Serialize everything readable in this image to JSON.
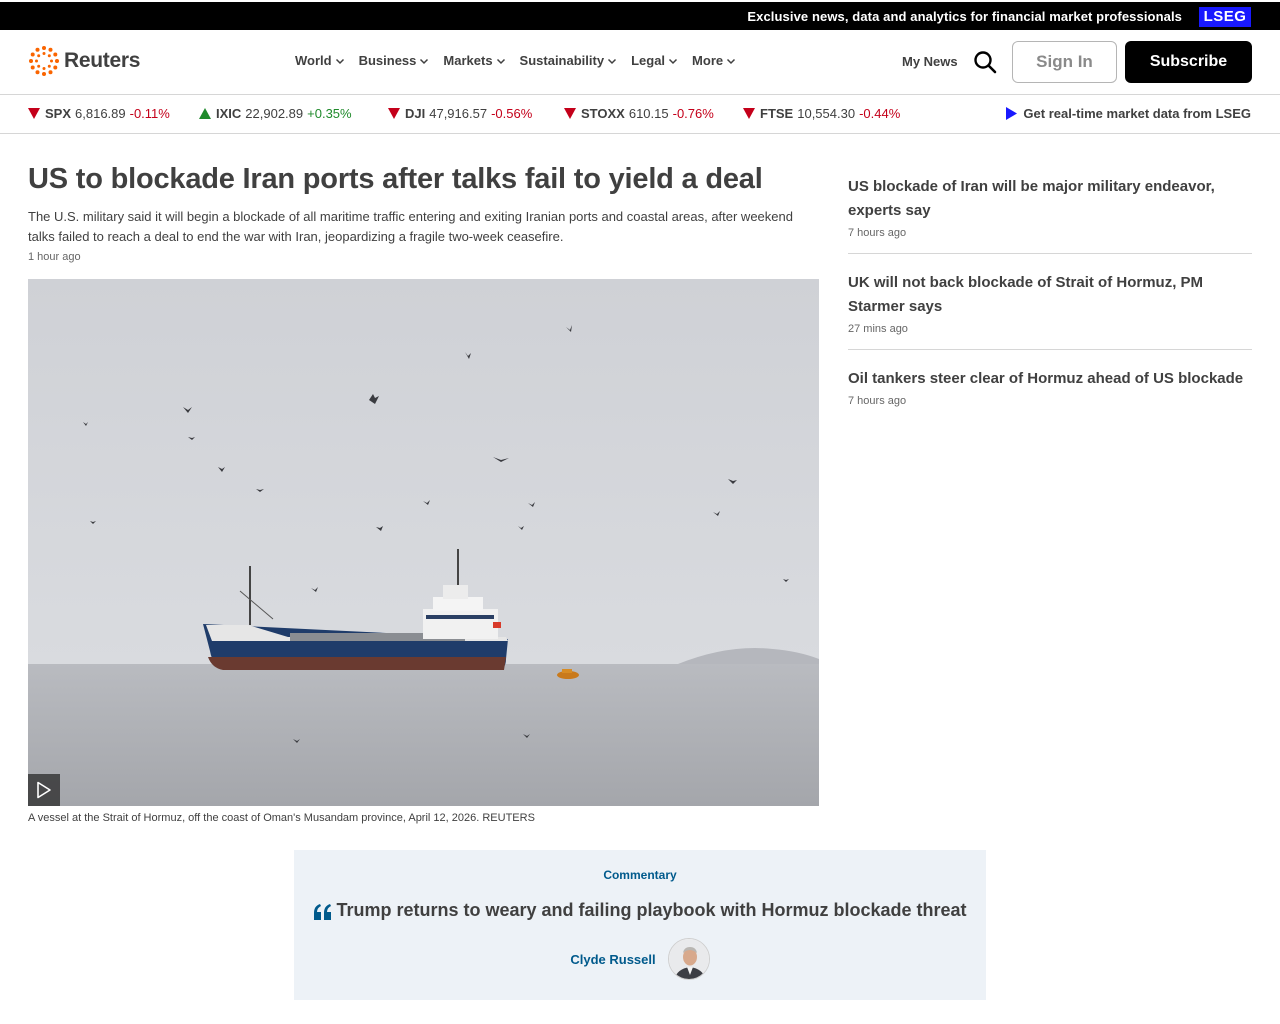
{
  "banner": {
    "text": "Exclusive news, data and analytics for financial market professionals",
    "badge": "LSEG"
  },
  "header": {
    "logo_text": "Reuters",
    "nav": [
      {
        "label": "World",
        "icon": "chevron-down-icon"
      },
      {
        "label": "Business",
        "icon": "chevron-down-icon"
      },
      {
        "label": "Markets",
        "icon": "chevron-down-icon"
      },
      {
        "label": "Sustainability",
        "icon": "chevron-down-icon"
      },
      {
        "label": "Legal",
        "icon": "chevron-down-icon"
      },
      {
        "label": "More",
        "icon": "chevron-down-icon"
      }
    ],
    "my_news": "My News",
    "sign_in": "Sign In",
    "subscribe": "Subscribe"
  },
  "ticker": {
    "items": [
      {
        "symbol": "SPX",
        "value": "6,816.89",
        "change": "-0.11%",
        "direction": "down"
      },
      {
        "symbol": "IXIC",
        "value": "22,902.89",
        "change": "+0.35%",
        "direction": "up"
      },
      {
        "symbol": "DJI",
        "value": "47,916.57",
        "change": "-0.56%",
        "direction": "down"
      },
      {
        "symbol": "STOXX",
        "value": "610.15",
        "change": "-0.76%",
        "direction": "down"
      },
      {
        "symbol": "FTSE",
        "value": "10,554.30",
        "change": "-0.44%",
        "direction": "down"
      }
    ],
    "lseg_link": "Get real-time market data from LSEG"
  },
  "main": {
    "headline": "US to blockade Iran ports after talks fail to yield a deal",
    "summary": "The U.S. military said it will begin a blockade of all maritime traffic entering and exiting Iranian ports and coastal areas, after weekend talks failed to reach a deal to end the war with Iran, jeopardizing a fragile two-week ceasefire.",
    "time": "1 hour ago",
    "caption": "A vessel at the Strait of Hormuz, off the coast of Oman's Musandam province, April 12, 2026. REUTERS"
  },
  "side": [
    {
      "title": "US blockade of Iran will be major military endeavor, experts say",
      "time": "7 hours ago"
    },
    {
      "title": "UK will not back blockade of Strait of Hormuz, PM Starmer says",
      "time": "27 mins ago"
    },
    {
      "title": "Oil tankers steer clear of Hormuz ahead of US blockade",
      "time": "7 hours ago"
    }
  ],
  "commentary": {
    "label": "Commentary",
    "title": "Trump returns to weary and failing playbook with Hormuz blockade threat",
    "author": "Clyde Russell"
  },
  "colors": {
    "negative": "#c4001a",
    "positive": "#1f8a2b",
    "accent_blue": "#005a8c",
    "lseg_blue": "#1919ff",
    "orange_logo": "#fa6400"
  }
}
